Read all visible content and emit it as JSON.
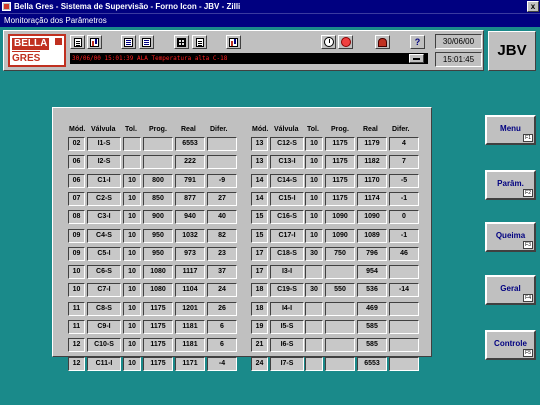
{
  "window": {
    "title": "Bella Gres - Sistema de Supervisão - Forno Icon - JBV - Zilli",
    "close_label": "x"
  },
  "subtitle": "Monitoração dos Parâmetros",
  "logo": {
    "line1": "BELLA",
    "line2": "GRES"
  },
  "alarm_text": "30/06/00 15:01:39 ALA Temperatura alta C-18",
  "date": "30/06/00",
  "time": "15:01:45",
  "station": "JBV",
  "table": {
    "headers": [
      "Mód.",
      "Válvula",
      "Tol.",
      "Prog.",
      "Real",
      "Difer."
    ],
    "left": [
      [
        "02",
        "I1-S",
        "",
        "",
        "6553",
        ""
      ],
      [
        "06",
        "I2-S",
        "",
        "",
        "222",
        ""
      ],
      [
        "06",
        "C1-I",
        "10",
        "800",
        "791",
        "-9"
      ],
      [
        "07",
        "C2-S",
        "10",
        "850",
        "877",
        "27"
      ],
      [
        "08",
        "C3-I",
        "10",
        "900",
        "940",
        "40"
      ],
      [
        "09",
        "C4-S",
        "10",
        "950",
        "1032",
        "82"
      ],
      [
        "09",
        "C5-I",
        "10",
        "950",
        "973",
        "23"
      ],
      [
        "10",
        "C6-S",
        "10",
        "1080",
        "1117",
        "37"
      ],
      [
        "10",
        "C7-I",
        "10",
        "1080",
        "1104",
        "24"
      ],
      [
        "11",
        "C8-S",
        "10",
        "1175",
        "1201",
        "26"
      ],
      [
        "11",
        "C9-I",
        "10",
        "1175",
        "1181",
        "6"
      ],
      [
        "12",
        "C10-S",
        "10",
        "1175",
        "1181",
        "6"
      ],
      [
        "12",
        "C11-I",
        "10",
        "1175",
        "1171",
        "-4"
      ]
    ],
    "right": [
      [
        "13",
        "C12-S",
        "10",
        "1175",
        "1179",
        "4"
      ],
      [
        "13",
        "C13-I",
        "10",
        "1175",
        "1182",
        "7"
      ],
      [
        "14",
        "C14-S",
        "10",
        "1175",
        "1170",
        "-5"
      ],
      [
        "14",
        "C15-I",
        "10",
        "1175",
        "1174",
        "-1"
      ],
      [
        "15",
        "C16-S",
        "10",
        "1090",
        "1090",
        "0"
      ],
      [
        "15",
        "C17-I",
        "10",
        "1090",
        "1089",
        "-1"
      ],
      [
        "17",
        "C18-S",
        "30",
        "750",
        "796",
        "46"
      ],
      [
        "17",
        "I3-I",
        "",
        "",
        "954",
        ""
      ],
      [
        "18",
        "C19-S",
        "30",
        "550",
        "536",
        "-14"
      ],
      [
        "18",
        "I4-I",
        "",
        "",
        "469",
        ""
      ],
      [
        "19",
        "I5-S",
        "",
        "",
        "585",
        ""
      ],
      [
        "21",
        "I6-S",
        "",
        "",
        "585",
        ""
      ],
      [
        "24",
        "I7-S",
        "",
        "",
        "6553",
        ""
      ]
    ]
  },
  "side_buttons": [
    {
      "label": "Menu",
      "key": "F1"
    },
    {
      "label": "Parâm.",
      "key": "F2"
    },
    {
      "label": "Queima",
      "key": "F3"
    },
    {
      "label": "Geral",
      "key": "F4"
    },
    {
      "label": "Controle",
      "key": "F5"
    }
  ],
  "colors": {
    "desktop": "#1a8a8a",
    "titlebar": "#000080",
    "panel": "#c0c0c0",
    "alarm": "#ff2020"
  },
  "toolbar_icons": [
    "report-icon",
    "chart-icon",
    "list-icon",
    "list-icon",
    "grid-icon",
    "table-icon",
    "battery-icon",
    "clock-icon",
    "alarm-icon",
    "user-icon",
    "help-icon"
  ]
}
